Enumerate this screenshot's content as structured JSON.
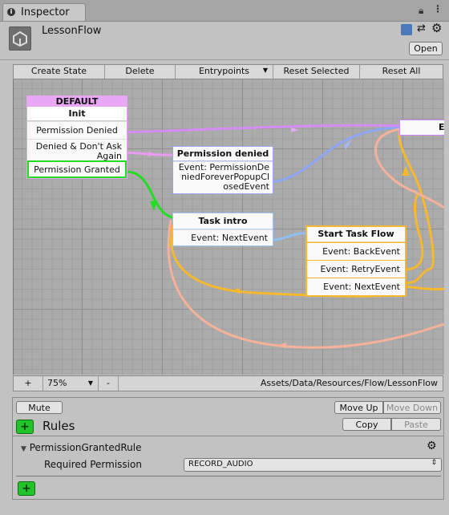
{
  "tab": {
    "label": "Inspector"
  },
  "header": {
    "title": "LessonFlow",
    "open_label": "Open"
  },
  "toolbar": {
    "create_state": "Create State",
    "delete": "Delete",
    "entrypoints": "Entrypoints",
    "reset_selected": "Reset Selected",
    "reset_all": "Reset All"
  },
  "graph": {
    "nodes": {
      "default": {
        "badge": "DEFAULT",
        "title": "Init",
        "rows": [
          "Permission Denied",
          "Denied & Don't Ask Again",
          "Permission Granted"
        ]
      },
      "permission_denied": {
        "title": "Permission denied",
        "event": "Event: PermissionDeniedForeverPopupClosedEvent"
      },
      "task_intro": {
        "title": "Task intro",
        "event": "Event: NextEvent"
      },
      "start_task_flow": {
        "title": "Start Task Flow",
        "events": [
          "Event: BackEvent",
          "Event: RetryEvent",
          "Event: NextEvent"
        ]
      },
      "clipped_node": {
        "title": "E"
      }
    },
    "colors": {
      "purple": "#cc88ff",
      "pink": "#e89bf0",
      "green": "#22dd22",
      "blue": "#8fa5f5",
      "lightblue": "#8fc0f0",
      "orange": "#f5b82e",
      "salmon": "#f5b19a"
    }
  },
  "bottombar": {
    "plus": "+",
    "zoom": "75%",
    "minus": "-",
    "path": "Assets/Data/Resources/Flow/LessonFlow"
  },
  "rules": {
    "mute": "Mute",
    "move_up": "Move Up",
    "move_down": "Move Down",
    "title": "Rules",
    "copy": "Copy",
    "paste": "Paste",
    "rule_name": "PermissionGrantedRule",
    "field_label": "Required Permission",
    "field_value": "RECORD_AUDIO"
  }
}
